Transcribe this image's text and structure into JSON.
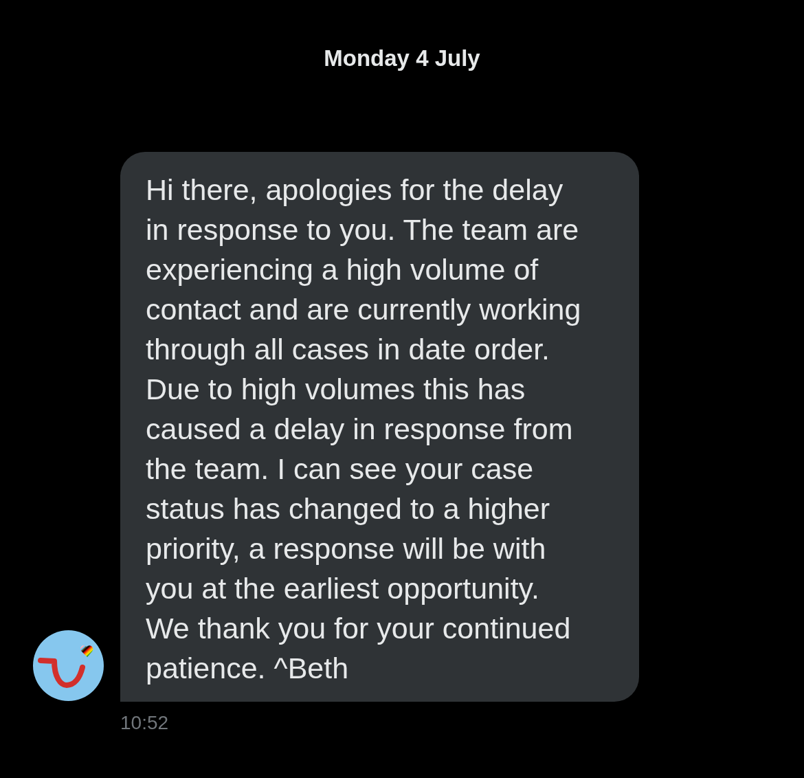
{
  "date_header": "Monday 4 July",
  "message": {
    "text": "Hi there, apologies for the delay in response to you. The team are experiencing a high volume of contact and are currently working through all cases in date order. Due to high volumes this has caused a delay in response from the team. I can see your case status has changed to a higher priority, a response will be with you at the earliest opportunity. We thank you for your continued patience. ^Beth",
    "time": "10:52"
  }
}
